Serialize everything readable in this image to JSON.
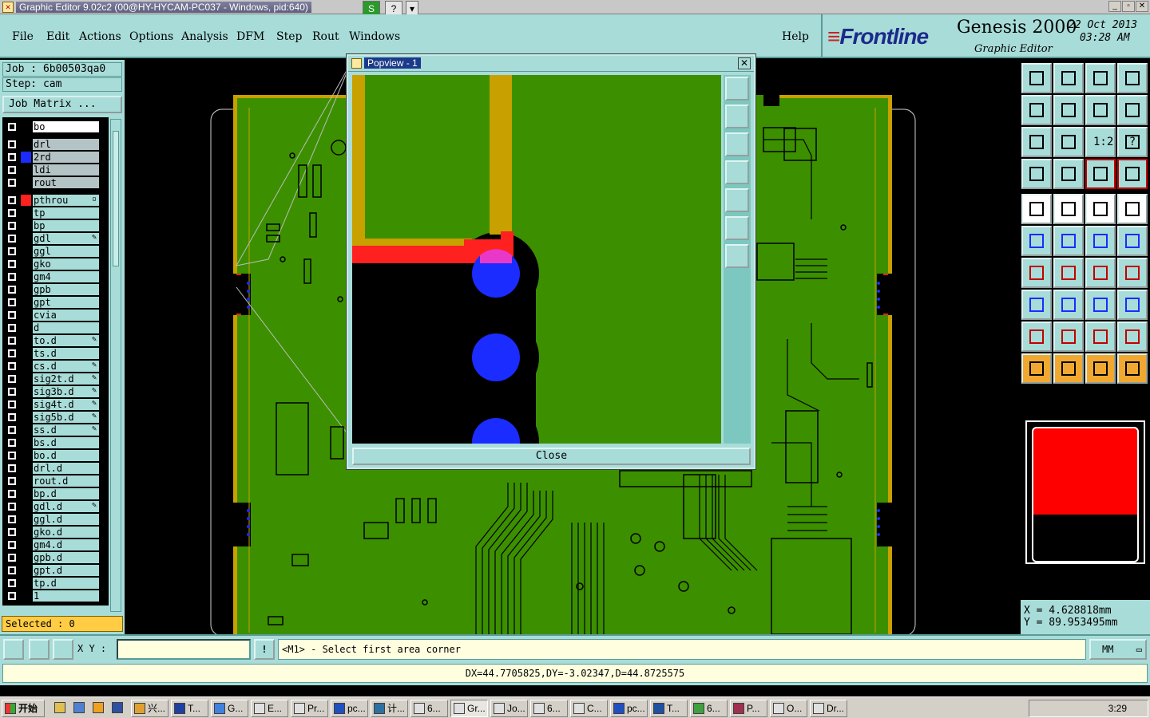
{
  "window": {
    "title": "Graphic Editor 9.02c2 (00@HY-HYCAM-PC037 - Windows, pid:640)",
    "toolbar_s": "S",
    "toolbar_help": "?",
    "toolbar_drop": "▾",
    "min": "_",
    "max": "▫",
    "close": "✕"
  },
  "menu": {
    "items": [
      "File",
      "Edit",
      "Actions",
      "Options",
      "Analysis",
      "DFM",
      "Step",
      "Rout",
      "Windows"
    ],
    "help": "Help"
  },
  "brand": {
    "logo": "Frontline",
    "product": "Genesis 2000",
    "subtitle": "Graphic Editor",
    "date": "22 Oct 2013",
    "time": "03:28 AM"
  },
  "left_panel": {
    "job": "Job : 6b00503qa0",
    "step": "Step: cam",
    "job_matrix": "Job Matrix ...",
    "layers": [
      {
        "name": "bo",
        "style": "white",
        "color": "",
        "mark": ""
      },
      {
        "name": "drl",
        "style": "gray",
        "color": "",
        "mark": ""
      },
      {
        "name": "2rd",
        "style": "gray",
        "color": "#1a2cff",
        "mark": ""
      },
      {
        "name": "ldi",
        "style": "gray",
        "color": "",
        "mark": ""
      },
      {
        "name": "rout",
        "style": "gray",
        "color": "",
        "mark": ""
      },
      {
        "name": "pthrou",
        "style": "teal",
        "color": "#ff2020",
        "mark": "▫"
      },
      {
        "name": "tp",
        "style": "teal",
        "color": "",
        "mark": ""
      },
      {
        "name": "bp",
        "style": "teal",
        "color": "",
        "mark": ""
      },
      {
        "name": "gdl",
        "style": "teal",
        "color": "",
        "mark": "✎"
      },
      {
        "name": "ggl",
        "style": "teal",
        "color": "",
        "mark": ""
      },
      {
        "name": "gko",
        "style": "teal",
        "color": "",
        "mark": ""
      },
      {
        "name": "gm4",
        "style": "teal",
        "color": "",
        "mark": ""
      },
      {
        "name": "gpb",
        "style": "teal",
        "color": "",
        "mark": ""
      },
      {
        "name": "gpt",
        "style": "teal",
        "color": "",
        "mark": ""
      },
      {
        "name": "cvia",
        "style": "teal",
        "color": "",
        "mark": ""
      },
      {
        "name": "d",
        "style": "teal",
        "color": "",
        "mark": ""
      },
      {
        "name": "to.d",
        "style": "teal",
        "color": "",
        "mark": "✎"
      },
      {
        "name": "ts.d",
        "style": "teal",
        "color": "",
        "mark": ""
      },
      {
        "name": "cs.d",
        "style": "teal",
        "color": "",
        "mark": "✎"
      },
      {
        "name": "sig2t.d",
        "style": "teal",
        "color": "",
        "mark": "✎"
      },
      {
        "name": "sig3b.d",
        "style": "teal",
        "color": "",
        "mark": "✎"
      },
      {
        "name": "sig4t.d",
        "style": "teal",
        "color": "",
        "mark": "✎"
      },
      {
        "name": "sig5b.d",
        "style": "teal",
        "color": "",
        "mark": "✎"
      },
      {
        "name": "ss.d",
        "style": "teal",
        "color": "",
        "mark": "✎"
      },
      {
        "name": "bs.d",
        "style": "teal",
        "color": "",
        "mark": ""
      },
      {
        "name": "bo.d",
        "style": "teal",
        "color": "",
        "mark": ""
      },
      {
        "name": "drl.d",
        "style": "teal",
        "color": "",
        "mark": ""
      },
      {
        "name": "rout.d",
        "style": "teal",
        "color": "",
        "mark": ""
      },
      {
        "name": "bp.d",
        "style": "teal",
        "color": "",
        "mark": ""
      },
      {
        "name": "gdl.d",
        "style": "teal",
        "color": "",
        "mark": "✎"
      },
      {
        "name": "ggl.d",
        "style": "teal",
        "color": "",
        "mark": ""
      },
      {
        "name": "gko.d",
        "style": "teal",
        "color": "",
        "mark": ""
      },
      {
        "name": "gm4.d",
        "style": "teal",
        "color": "",
        "mark": ""
      },
      {
        "name": "gpb.d",
        "style": "teal",
        "color": "",
        "mark": ""
      },
      {
        "name": "gpt.d",
        "style": "teal",
        "color": "",
        "mark": ""
      },
      {
        "name": "tp.d",
        "style": "teal",
        "color": "",
        "mark": ""
      },
      {
        "name": "1",
        "style": "teal",
        "color": "",
        "mark": ""
      }
    ],
    "selected": "Selected : 0"
  },
  "popview": {
    "title": "Popview - 1",
    "close_button": "Close"
  },
  "right_panel": {
    "x_readout": "X  =  4.628818mm",
    "y_readout": "Y  = 89.953495mm",
    "tool_one_to_two": "1:2",
    "tool_help": "?"
  },
  "command_bar": {
    "xy_label": "X Y :",
    "xy_value": "",
    "alert_icon": "!",
    "prompt": "<M1> - Select first area corner",
    "units": "MM"
  },
  "status": {
    "text": "DX=44.7705825,DY=-3.02347,D=44.8725575"
  },
  "taskbar": {
    "start": "开始",
    "tasks": [
      "兴...",
      "T...",
      "G...",
      "E...",
      "Pr...",
      "pc...",
      "计...",
      "6...",
      "Gr...",
      "Jo...",
      "6...",
      "C...",
      "pc...",
      "T...",
      "6...",
      "P...",
      "O...",
      "Dr..."
    ],
    "clock": "3:29"
  },
  "colors": {
    "panel": "#a8dcd8",
    "board": "#3c9000",
    "trace": "#c8a000",
    "highlight": "#ff2020",
    "pad": "#1a2cff"
  }
}
